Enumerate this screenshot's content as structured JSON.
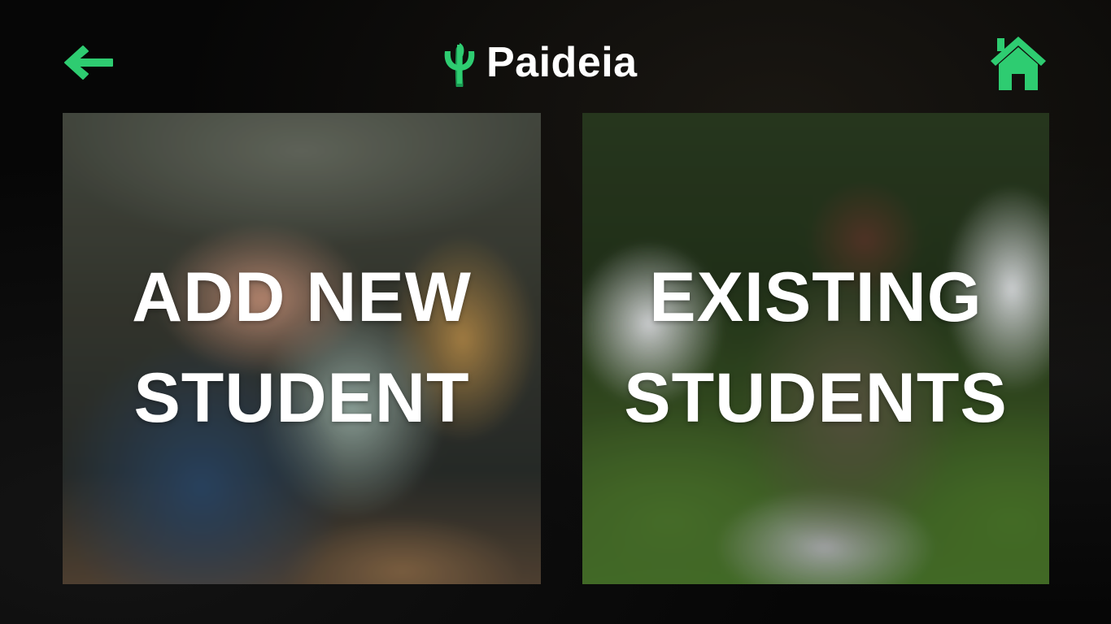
{
  "header": {
    "brand_name": "Paideia",
    "back_icon": "arrow-left-icon",
    "home_icon": "home-icon",
    "logo_icon": "psi-leaf-logo-icon"
  },
  "cards": [
    {
      "id": "add-new-student",
      "line1": "ADD NEW",
      "line2": "STUDENT"
    },
    {
      "id": "existing-students",
      "line1": "EXISTING",
      "line2": "STUDENTS"
    }
  ],
  "colors": {
    "accent": "#2ecc71",
    "accent_dark": "#1a9a52",
    "text": "#ffffff",
    "background": "#060606"
  }
}
